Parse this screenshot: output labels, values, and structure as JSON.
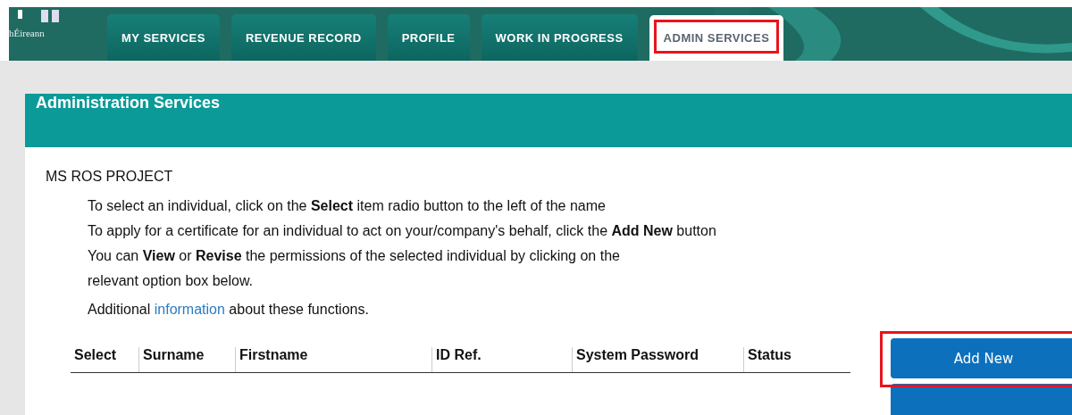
{
  "header": {
    "logo_text": "hÉireann"
  },
  "tabs": [
    {
      "label": "MY SERVICES",
      "selected": false,
      "highlighted": false
    },
    {
      "label": "REVENUE RECORD",
      "selected": false,
      "highlighted": false
    },
    {
      "label": "PROFILE",
      "selected": false,
      "highlighted": false
    },
    {
      "label": "WORK IN PROGRESS",
      "selected": false,
      "highlighted": false
    },
    {
      "label": "ADMIN SERVICES",
      "selected": true,
      "highlighted": true
    }
  ],
  "panel": {
    "title": "Administration Services",
    "organisation": "MS ROS PROJECT",
    "instructions": [
      "To select an individual, click on the **Select** item radio button to the left of the name",
      "To apply for a certificate for an individual to act on your/company's behalf, click the **Add New** button",
      "You can **View** or **Revise** the permissions of the selected individual by clicking on the relevant option box below."
    ],
    "info": {
      "before": "Additional",
      "link": "information",
      "after": "about these functions."
    }
  },
  "table": {
    "columns": [
      "Select",
      "Surname",
      "Firstname",
      "ID Ref.",
      "System Password",
      "Status"
    ]
  },
  "buttons": [
    {
      "label": "Add New",
      "highlighted": true
    }
  ]
}
